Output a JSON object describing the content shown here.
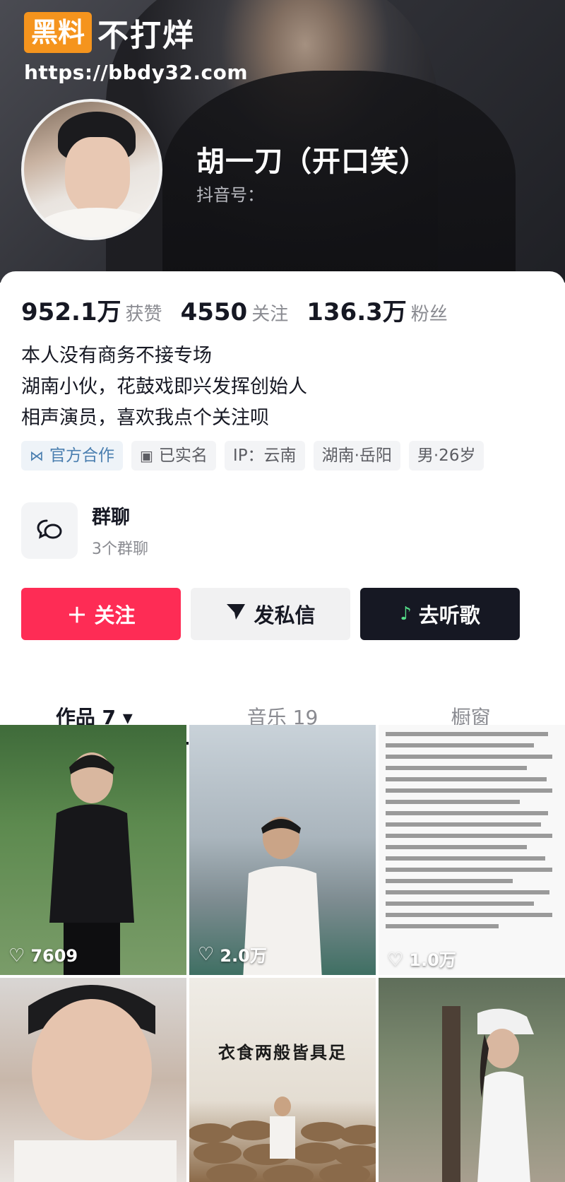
{
  "watermark": {
    "brand_badge": "黑料",
    "brand_text": "不打烊",
    "url": "https://bbdy32.com"
  },
  "profile": {
    "name": "胡一刀（开口笑）",
    "douyin_id_label": "抖音号：",
    "douyin_id_value": "                 ",
    "stats": [
      {
        "value": "952.1万",
        "label": "获赞"
      },
      {
        "value": "4550",
        "label": "关注"
      },
      {
        "value": "136.3万",
        "label": "粉丝"
      }
    ],
    "bio": [
      "本人没有商务不接专场",
      "湖南小伙，花鼓戏即兴发挥创始人",
      "相声演员，喜欢我点个关注呗"
    ],
    "tags": [
      {
        "icon": "verified-icon",
        "label": "官方合作"
      },
      {
        "icon": "id-card-icon",
        "label": "已实名"
      },
      {
        "label": "IP：云南"
      },
      {
        "label": "湖南·岳阳"
      },
      {
        "label": "男·26岁"
      }
    ],
    "group_chat": {
      "title": "群聊",
      "subtitle": "3个群聊"
    }
  },
  "actions": {
    "follow_label": "关注",
    "message_label": "发私信",
    "music_label": "去听歌"
  },
  "tabs": [
    {
      "label": "作品 7 ▾",
      "active": true
    },
    {
      "label": "音乐 19",
      "active": false
    },
    {
      "label": "橱窗",
      "active": false
    }
  ],
  "videos": [
    {
      "likes": "7609"
    },
    {
      "likes": "2.0万"
    },
    {
      "likes": "1.0万"
    },
    {
      "likes": ""
    },
    {
      "likes": "",
      "caption": "衣食两般皆具足"
    },
    {
      "likes": ""
    }
  ],
  "colors": {
    "follow_button": "#fe2c55",
    "music_button": "#161823",
    "watermark_orange": "#f5941d"
  }
}
